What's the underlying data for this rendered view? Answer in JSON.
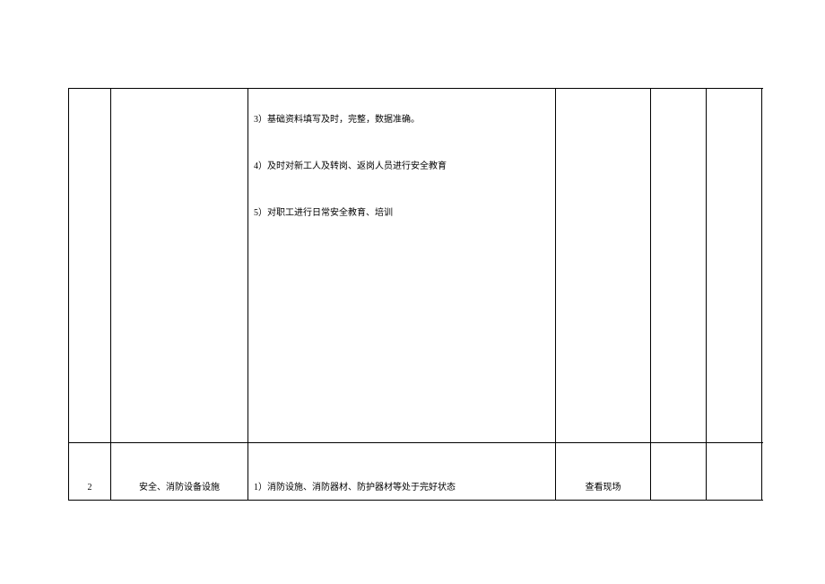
{
  "rows": [
    {
      "col1": "",
      "col2": "",
      "col3_lines": [
        "3）基础资料填写及时，完整，数据准确。",
        "4）及时对新工人及转岗、返岗人员进行安全教育",
        "5）对职工进行日常安全教育、培训"
      ],
      "col4": "",
      "col5": "",
      "col6": ""
    },
    {
      "col1": "2",
      "col2": "安全、消防设备设施",
      "col3": "1）消防设施、消防器材、防护器材等处于完好状态",
      "col4": "查看现场",
      "col5": "",
      "col6": ""
    }
  ]
}
